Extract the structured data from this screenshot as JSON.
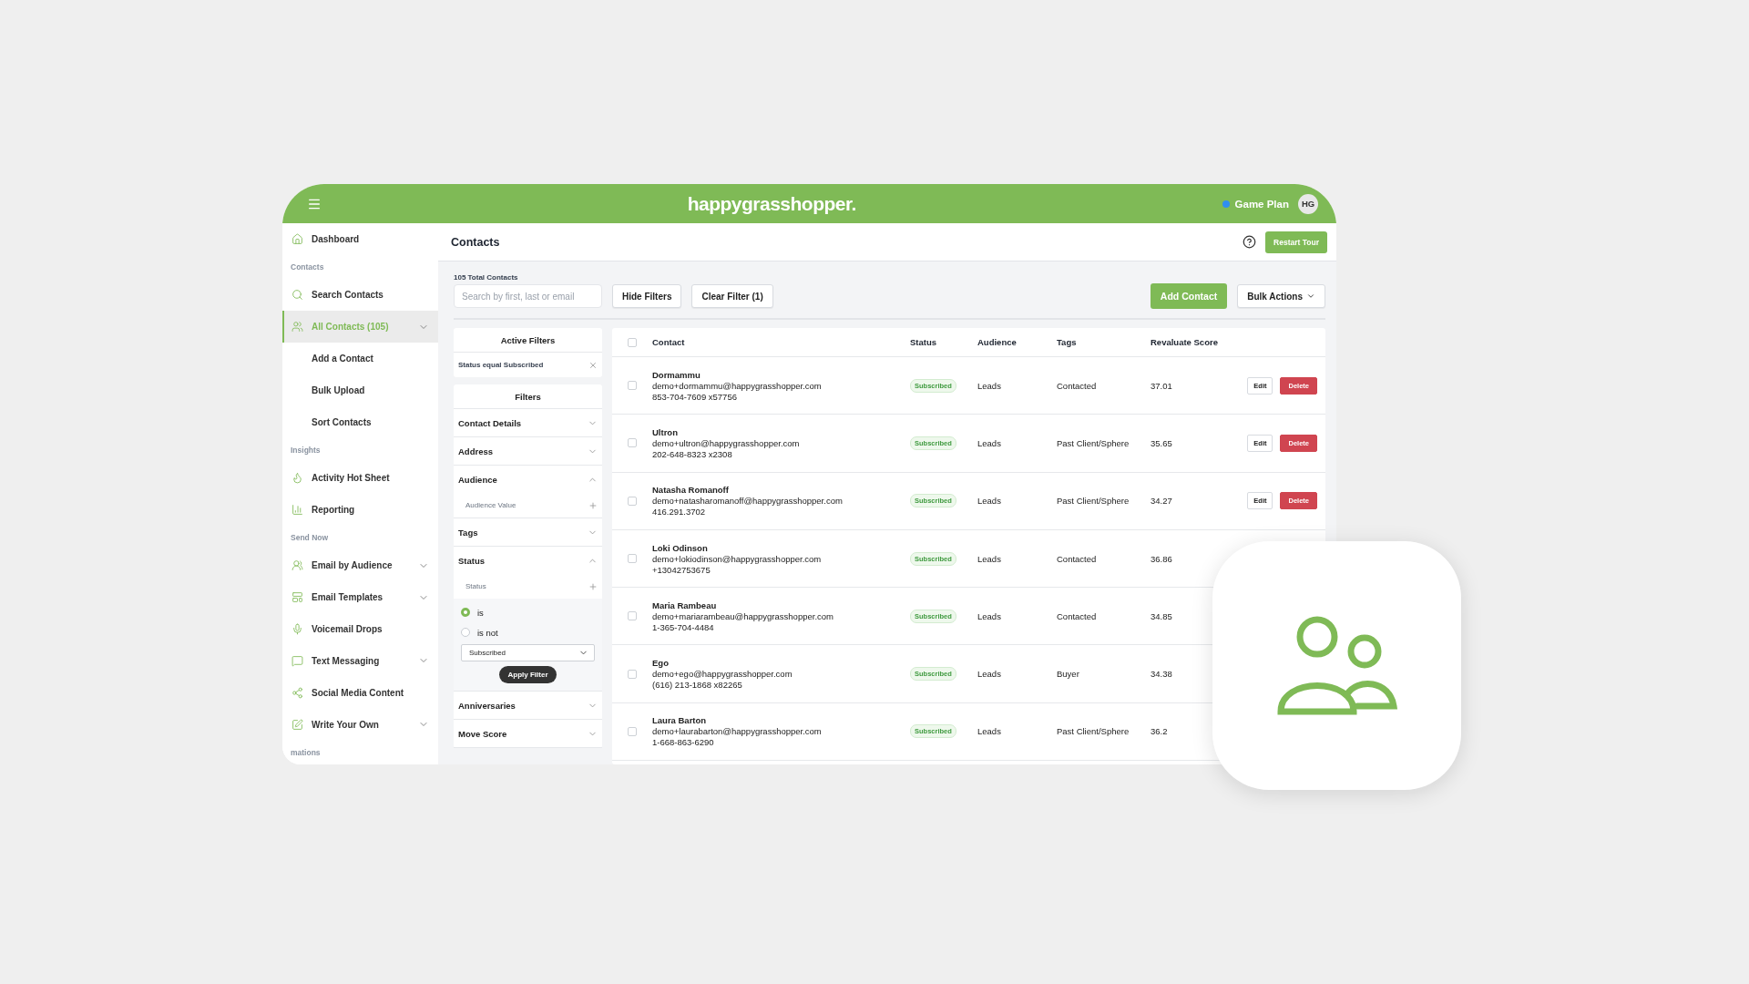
{
  "header": {
    "logo": "happygrasshopper.",
    "plan_label": "Game Plan",
    "avatar": "HG"
  },
  "sidebar": {
    "items": [
      {
        "kind": "link",
        "label": "Dashboard",
        "selected": false,
        "has_submenu": false
      },
      {
        "kind": "section",
        "label": "Contacts"
      },
      {
        "kind": "link",
        "label": "Search Contacts",
        "selected": false,
        "has_submenu": false
      },
      {
        "kind": "link",
        "label": "All Contacts (105)",
        "selected": true,
        "has_submenu": true,
        "children": [
          {
            "label": "Add a Contact"
          },
          {
            "label": "Bulk Upload"
          },
          {
            "label": "Sort Contacts"
          }
        ]
      },
      {
        "kind": "section",
        "label": "Insights"
      },
      {
        "kind": "link",
        "label": "Activity Hot Sheet",
        "selected": false,
        "has_submenu": false
      },
      {
        "kind": "link",
        "label": "Reporting",
        "selected": false,
        "has_submenu": false
      },
      {
        "kind": "section",
        "label": "Send Now"
      },
      {
        "kind": "link",
        "label": "Email by Audience",
        "selected": false,
        "has_submenu": true
      },
      {
        "kind": "link",
        "label": "Email Templates",
        "selected": false,
        "has_submenu": true
      },
      {
        "kind": "link",
        "label": "Voicemail Drops",
        "selected": false,
        "has_submenu": false
      },
      {
        "kind": "link",
        "label": "Text Messaging",
        "selected": false,
        "has_submenu": true
      },
      {
        "kind": "link",
        "label": "Social Media Content",
        "selected": false,
        "has_submenu": false
      },
      {
        "kind": "link",
        "label": "Write Your Own",
        "selected": false,
        "has_submenu": true
      },
      {
        "kind": "section",
        "label": "mations"
      }
    ]
  },
  "page": {
    "title": "Contacts",
    "restart_button": "Restart Tour"
  },
  "toolbar": {
    "total": "105 Total Contacts",
    "search": {
      "placeholder": "Search by first, last or email"
    },
    "hide_filters": "Hide Filters",
    "clear_filter": "Clear Filter (1)",
    "add_contact": "Add Contact",
    "bulk_actions": "Bulk Actions"
  },
  "active_filters": {
    "title": "Active Filters",
    "items": [
      "Status equal Subscribed"
    ]
  },
  "filters": {
    "title": "Filters",
    "items": [
      {
        "label": "Contact Details",
        "expanded": false
      },
      {
        "label": "Address",
        "expanded": false
      },
      {
        "label": "Audience",
        "expanded": true,
        "sub_label": "Audience Value"
      },
      {
        "label": "Tags",
        "expanded": false
      },
      {
        "label": "Status",
        "expanded": true,
        "sub_label": "Status",
        "options": [
          {
            "label": "is",
            "selected": true
          },
          {
            "label": "is not",
            "selected": false
          }
        ],
        "select_value": "Subscribed",
        "apply": "Apply Filter"
      },
      {
        "label": "Anniversaries",
        "expanded": false
      },
      {
        "label": "Move Score",
        "expanded": false
      }
    ]
  },
  "table": {
    "columns": [
      "Contact",
      "Status",
      "Audience",
      "Tags",
      "Revaluate Score"
    ],
    "all_checked": false,
    "rows": [
      {
        "checked": false,
        "name": "Dormammu",
        "email": "demo+dormammu@happygrasshopper.com",
        "phone": "853-704-7609 x57756",
        "status": "Subscribed",
        "audience": "Leads",
        "tags": "Contacted",
        "score": "37.01",
        "actions": [
          "Edit",
          "Delete"
        ]
      },
      {
        "checked": false,
        "name": "Ultron",
        "email": "demo+ultron@happygrasshopper.com",
        "phone": "202-648-8323 x2308",
        "status": "Subscribed",
        "audience": "Leads",
        "tags": "Past Client/Sphere",
        "score": "35.65",
        "actions": [
          "Edit",
          "Delete"
        ]
      },
      {
        "checked": false,
        "name": "Natasha Romanoff",
        "email": "demo+natasharomanoff@happygrasshopper.com",
        "phone": "416.291.3702",
        "status": "Subscribed",
        "audience": "Leads",
        "tags": "Past Client/Sphere",
        "score": "34.27",
        "actions": [
          "Edit",
          "Delete"
        ]
      },
      {
        "checked": false,
        "name": "Loki Odinson",
        "email": "demo+lokiodinson@happygrasshopper.com",
        "phone": "+13042753675",
        "status": "Subscribed",
        "audience": "Leads",
        "tags": "Contacted",
        "score": "36.86"
      },
      {
        "checked": false,
        "name": "Maria Rambeau",
        "email": "demo+mariarambeau@happygrasshopper.com",
        "phone": "1-365-704-4484",
        "status": "Subscribed",
        "audience": "Leads",
        "tags": "Contacted",
        "score": "34.85"
      },
      {
        "checked": false,
        "name": "Ego",
        "email": "demo+ego@happygrasshopper.com",
        "phone": "(616) 213-1868 x82265",
        "status": "Subscribed",
        "audience": "Leads",
        "tags": "Buyer",
        "score": "34.38"
      },
      {
        "checked": false,
        "name": "Laura Barton",
        "email": "demo+laurabarton@happygrasshopper.com",
        "phone": "1-668-863-6290",
        "status": "Subscribed",
        "audience": "Leads",
        "tags": "Past Client/Sphere",
        "score": "36.2"
      }
    ]
  }
}
